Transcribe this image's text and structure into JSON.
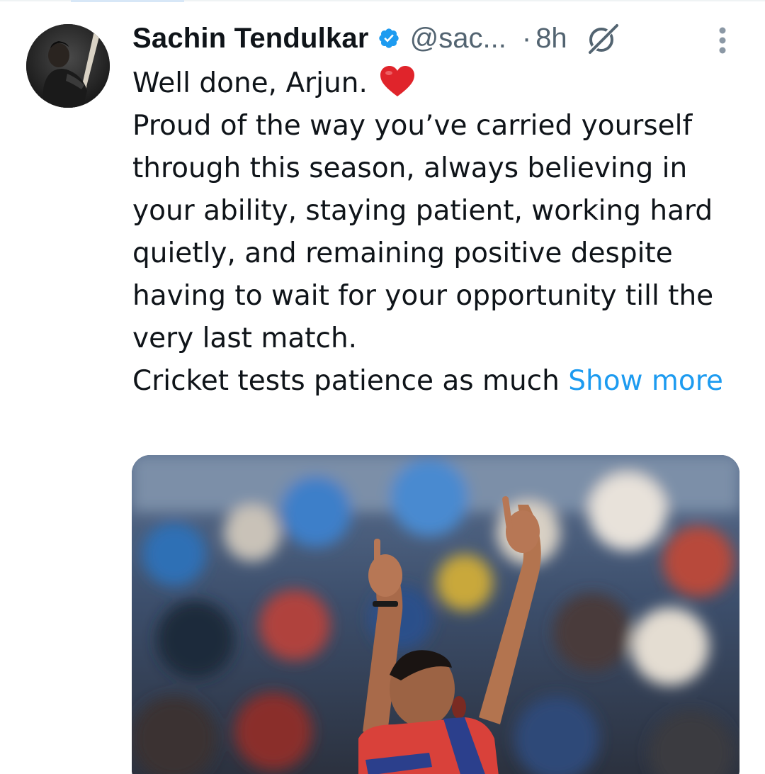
{
  "tweet": {
    "author": {
      "display_name": "Sachin Tendulkar",
      "handle": "@sac...",
      "verified": true,
      "avatar_icon": "profile-photo"
    },
    "separator": "·",
    "timestamp": "8h",
    "icons": {
      "verified": "verified-badge-icon",
      "grok": "grok-icon",
      "more": "more-vertical-icon",
      "heart": "red-heart-emoji"
    },
    "text": {
      "line1": "Well done, Arjun.",
      "paragraph2": "Proud of the way you’ve carried yourself through this season, always believing in your ability, staying patient, working hard quietly, and remaining positive despite having to wait for your opportunity till the very last match.",
      "paragraph3": "Cricket tests patience as much",
      "show_more": "Show more"
    },
    "media": {
      "type": "photo",
      "subject": "cricketer-celebrating"
    }
  },
  "colors": {
    "accent": "#1d9bf0",
    "text_primary": "#0f1419",
    "text_secondary": "#536471",
    "heart": "#e0242b"
  }
}
